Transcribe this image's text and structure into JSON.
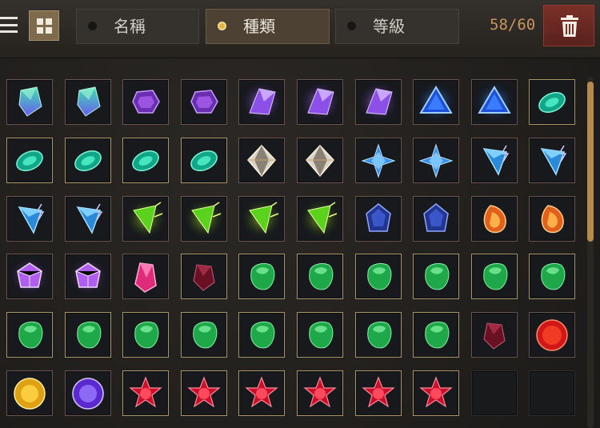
{
  "toolbar": {
    "menu_icon": "hamburger-menu-icon",
    "grid_icon": "grid-view-icon",
    "tabs": [
      {
        "label": "名稱",
        "selected": false
      },
      {
        "label": "種類",
        "selected": true
      },
      {
        "label": "等級",
        "selected": false
      }
    ],
    "capacity": "58/60",
    "trash_icon": "trash-icon"
  },
  "colors": {
    "accent": "#e2b246",
    "count": "#c9955f",
    "trash_bg": "#7a2f28"
  },
  "inventory": {
    "columns": 10,
    "slots": [
      {
        "item": "teal-purple-crystal",
        "frame": "red"
      },
      {
        "item": "teal-purple-crystal",
        "frame": "red"
      },
      {
        "item": "purple-hexagon-gem",
        "frame": "red"
      },
      {
        "item": "purple-hexagon-gem",
        "frame": "red"
      },
      {
        "item": "violet-shard",
        "frame": "red"
      },
      {
        "item": "violet-shard",
        "frame": "red"
      },
      {
        "item": "violet-shard",
        "frame": "red"
      },
      {
        "item": "blue-triangle-gem",
        "frame": "red"
      },
      {
        "item": "blue-triangle-gem",
        "frame": "red"
      },
      {
        "item": "teal-oval-gem",
        "frame": "gold"
      },
      {
        "item": "teal-oval-gem",
        "frame": "gold"
      },
      {
        "item": "teal-oval-gem",
        "frame": "gold"
      },
      {
        "item": "teal-oval-gem",
        "frame": "gold"
      },
      {
        "item": "teal-oval-gem",
        "frame": "gold"
      },
      {
        "item": "white-diamond",
        "frame": "red"
      },
      {
        "item": "white-diamond",
        "frame": "red"
      },
      {
        "item": "blue-star-diamond",
        "frame": "red"
      },
      {
        "item": "blue-star-diamond",
        "frame": "red"
      },
      {
        "item": "blue-lightning-crystal",
        "frame": "red"
      },
      {
        "item": "blue-lightning-crystal",
        "frame": "red"
      },
      {
        "item": "blue-lightning-crystal",
        "frame": "red"
      },
      {
        "item": "blue-lightning-crystal",
        "frame": "red"
      },
      {
        "item": "green-spike-crystal",
        "frame": "red"
      },
      {
        "item": "green-spike-crystal",
        "frame": "red"
      },
      {
        "item": "green-spike-crystal",
        "frame": "red"
      },
      {
        "item": "green-spike-crystal",
        "frame": "red"
      },
      {
        "item": "dark-blue-gem",
        "frame": "red"
      },
      {
        "item": "dark-blue-gem",
        "frame": "red"
      },
      {
        "item": "orange-teardrop-gem",
        "frame": "red"
      },
      {
        "item": "orange-teardrop-gem",
        "frame": "red"
      },
      {
        "item": "purple-facet-gem",
        "frame": "red"
      },
      {
        "item": "purple-facet-gem",
        "frame": "red"
      },
      {
        "item": "pink-crystal",
        "frame": "red"
      },
      {
        "item": "dark-ruby",
        "frame": "gold"
      },
      {
        "item": "green-stone",
        "frame": "gold"
      },
      {
        "item": "green-stone",
        "frame": "gold"
      },
      {
        "item": "green-stone",
        "frame": "gold"
      },
      {
        "item": "green-stone",
        "frame": "gold"
      },
      {
        "item": "green-stone",
        "frame": "gold"
      },
      {
        "item": "green-stone",
        "frame": "gold"
      },
      {
        "item": "green-stone",
        "frame": "gold"
      },
      {
        "item": "green-stone",
        "frame": "gold"
      },
      {
        "item": "green-stone",
        "frame": "gold"
      },
      {
        "item": "green-stone",
        "frame": "gold"
      },
      {
        "item": "green-stone",
        "frame": "gold"
      },
      {
        "item": "green-stone",
        "frame": "gold"
      },
      {
        "item": "green-stone",
        "frame": "gold"
      },
      {
        "item": "green-stone",
        "frame": "gold"
      },
      {
        "item": "dark-ruby",
        "frame": "red"
      },
      {
        "item": "red-orb",
        "frame": "red"
      },
      {
        "item": "gold-orb",
        "frame": "red"
      },
      {
        "item": "purple-orb",
        "frame": "red"
      },
      {
        "item": "red-star-gem",
        "frame": "gold"
      },
      {
        "item": "red-star-gem",
        "frame": "gold"
      },
      {
        "item": "red-star-gem",
        "frame": "gold"
      },
      {
        "item": "red-star-gem",
        "frame": "gold"
      },
      {
        "item": "red-star-gem",
        "frame": "gold"
      },
      {
        "item": "red-star-gem",
        "frame": "gold"
      },
      {
        "item": "empty",
        "frame": "empty"
      },
      {
        "item": "empty",
        "frame": "empty"
      }
    ]
  },
  "scroll": {
    "position": 0.0
  }
}
